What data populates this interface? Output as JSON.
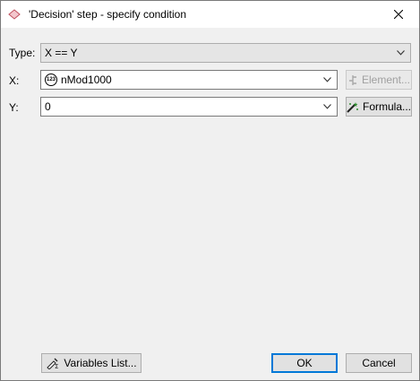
{
  "window": {
    "title": "'Decision' step - specify condition"
  },
  "form": {
    "type": {
      "label": "Type:",
      "value": "X == Y"
    },
    "x": {
      "label": "X:",
      "value": "nMod1000",
      "icon": "numeric-variable-icon"
    },
    "y": {
      "label": "Y:",
      "value": "0"
    }
  },
  "buttons": {
    "element": "Element...",
    "formula": "Formula...",
    "variables_list": "Variables List...",
    "ok": "OK",
    "cancel": "Cancel"
  },
  "icons": {
    "var_badge": "123"
  }
}
